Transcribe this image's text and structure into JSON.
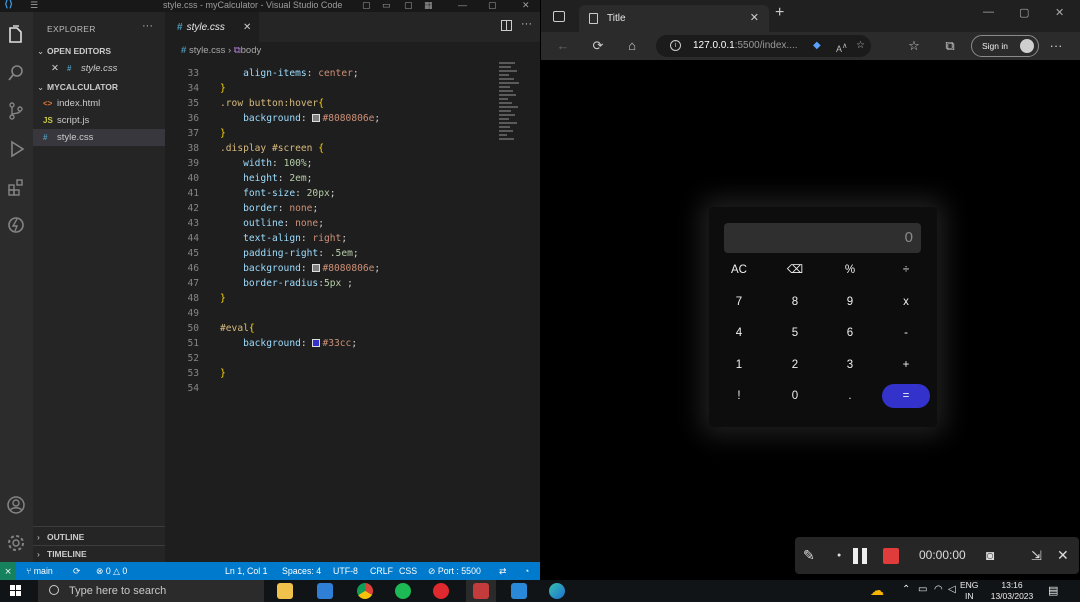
{
  "vscode": {
    "title": "style.css - myCalculator - Visual Studio Code",
    "explorer_header": "EXPLORER",
    "open_editors_label": "OPEN EDITORS",
    "open_editors": [
      {
        "name": "style.css"
      }
    ],
    "folder_label": "MYCALCULATOR",
    "files": [
      {
        "name": "index.html",
        "icon": "<>",
        "icon_color": "#e37933"
      },
      {
        "name": "script.js",
        "icon": "JS",
        "icon_color": "#cbcb41"
      },
      {
        "name": "style.css",
        "icon": "#",
        "icon_color": "#519aba"
      }
    ],
    "outline_label": "OUTLINE",
    "timeline_label": "TIMELINE",
    "tab_label": "style.css",
    "breadcrumb_file": "style.css",
    "breadcrumb_node": "body",
    "code_lines": [
      {
        "n": "33",
        "t": "    align-items: center;"
      },
      {
        "n": "34",
        "t": "}"
      },
      {
        "n": "35",
        "t": ".row button:hover{"
      },
      {
        "n": "36",
        "t": "    background: #8080806e;"
      },
      {
        "n": "37",
        "t": "}"
      },
      {
        "n": "38",
        "t": ".display #screen {"
      },
      {
        "n": "39",
        "t": "    width: 100%;"
      },
      {
        "n": "40",
        "t": "    height: 2em;"
      },
      {
        "n": "41",
        "t": "    font-size: 20px;"
      },
      {
        "n": "42",
        "t": "    border: none;"
      },
      {
        "n": "43",
        "t": "    outline: none;"
      },
      {
        "n": "44",
        "t": "    text-align: right;"
      },
      {
        "n": "45",
        "t": "    padding-right: .5em;"
      },
      {
        "n": "46",
        "t": "    background: #8080806e;"
      },
      {
        "n": "47",
        "t": "    border-radius:5px ;"
      },
      {
        "n": "48",
        "t": "}"
      },
      {
        "n": "49",
        "t": ""
      },
      {
        "n": "50",
        "t": "#eval{"
      },
      {
        "n": "51",
        "t": "    background: #33cc;"
      },
      {
        "n": "52",
        "t": ""
      },
      {
        "n": "53",
        "t": "}"
      },
      {
        "n": "54",
        "t": ""
      }
    ],
    "status": {
      "branch": "main",
      "problems": "0",
      "warnings": "0",
      "position": "Ln 1, Col 1",
      "spaces": "Spaces: 4",
      "encoding": "UTF-8",
      "eol": "CRLF",
      "language": "CSS",
      "port": "Port : 5500"
    }
  },
  "browser": {
    "tab_title": "Title",
    "url_main": "127.0.0.1",
    "url_rest": ":5500/index....",
    "signin_label": "Sign in"
  },
  "calculator": {
    "display_value": "0",
    "keys": [
      [
        "AC",
        "⌫",
        "%",
        "÷"
      ],
      [
        "7",
        "8",
        "9",
        "x"
      ],
      [
        "4",
        "5",
        "6",
        "-"
      ],
      [
        "1",
        "2",
        "3",
        "+"
      ],
      [
        "!",
        "0",
        ".",
        "="
      ]
    ],
    "eval_color": "#3333cc"
  },
  "recorder": {
    "timer": "00:00:00"
  },
  "taskbar": {
    "search_placeholder": "Type here to search",
    "lang_line1": "ENG",
    "lang_line2": "IN",
    "time": "13:16",
    "date": "13/03/2023"
  }
}
